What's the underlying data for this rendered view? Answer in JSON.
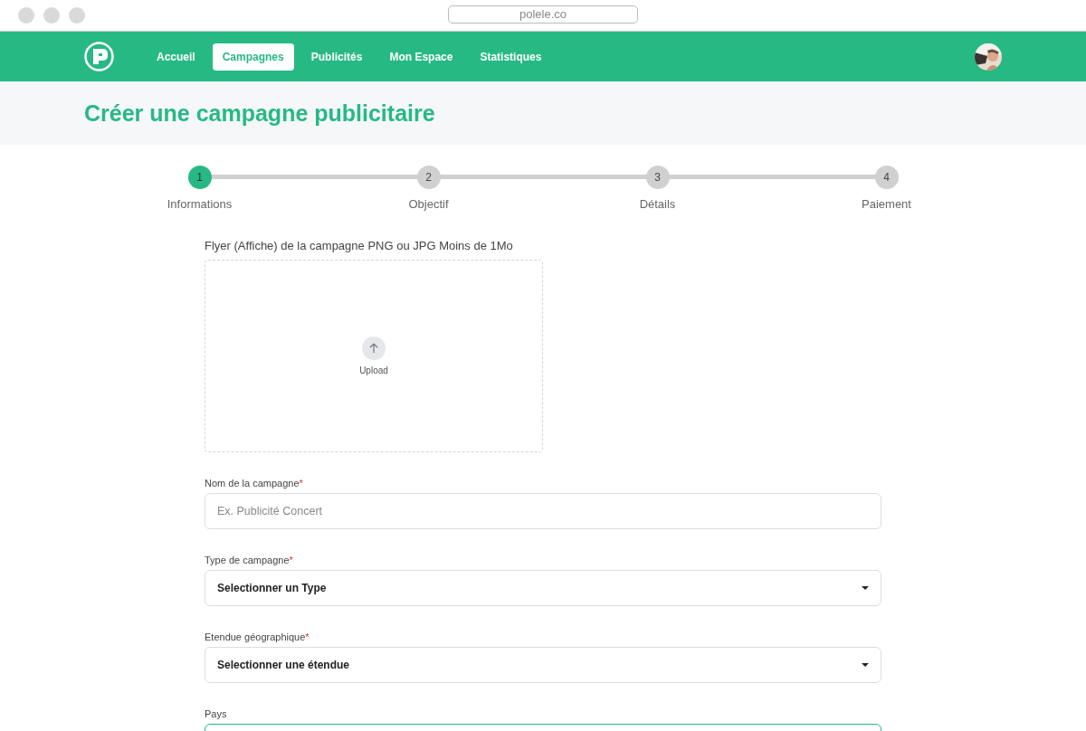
{
  "browser": {
    "address": "polele.co"
  },
  "nav": {
    "links": [
      {
        "label": "Accueil",
        "selected": false
      },
      {
        "label": "Campagnes",
        "selected": true
      },
      {
        "label": "Publicités",
        "selected": false
      },
      {
        "label": "Mon Espace",
        "selected": false
      },
      {
        "label": "Statistiques",
        "selected": false
      }
    ]
  },
  "page": {
    "title": "Créer une campagne publicitaire"
  },
  "stepper": {
    "steps": [
      {
        "number": "1",
        "label": "Informations",
        "selected": true
      },
      {
        "number": "2",
        "label": "Objectif",
        "selected": false
      },
      {
        "number": "3",
        "label": "Détails",
        "selected": false
      },
      {
        "number": "4",
        "label": "Paiement",
        "selected": false
      }
    ]
  },
  "upload": {
    "label": "Flyer (Affiche) de la campagne PNG ou JPG Moins de 1Mo",
    "button": "Upload"
  },
  "fields": [
    {
      "kind": "text",
      "label": "Nom de la campagne",
      "required_mark": "*",
      "placeholder": "Ex. Publicité Concert",
      "focused": false
    },
    {
      "kind": "select",
      "label": "Type de campagne",
      "required_mark": "*",
      "value": "Selectionner un Type",
      "focused": false
    },
    {
      "kind": "select",
      "label": "Etendue géographique",
      "required_mark": "*",
      "value": "Selectionner une étendue",
      "focused": false
    },
    {
      "kind": "text",
      "label": "Pays",
      "focused": true
    }
  ]
}
